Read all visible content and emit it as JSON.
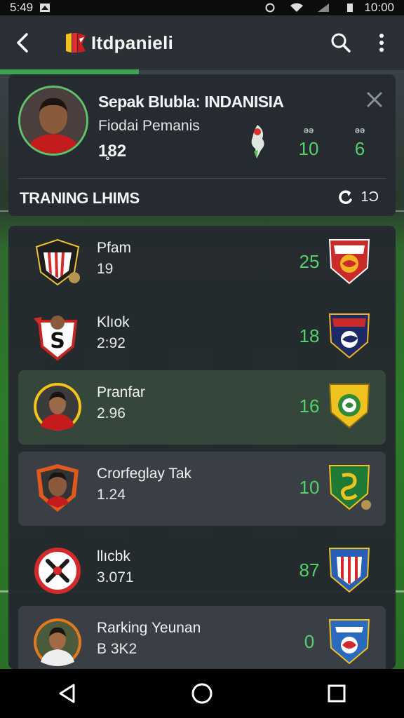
{
  "status_bar": {
    "time": "5:49",
    "clock_right": "10:00"
  },
  "app_bar": {
    "title": "Itdpanieli",
    "icons": [
      "back-arrow-icon",
      "app-logo-icon",
      "search-icon",
      "more-vert-icon"
    ]
  },
  "profile": {
    "name": "Sepak Blublaː INDANISIA",
    "subtitle": "Fiodai Pemanis",
    "number": "1̥82",
    "stats": [
      {
        "label": "ǝǝ",
        "value": "10"
      },
      {
        "label": "ǝǝ",
        "value": "6"
      }
    ]
  },
  "section": {
    "title": "TRANING LHIMS",
    "count": "1Ɔ"
  },
  "colors": {
    "accent_green": "#55d06a",
    "card_bg": "#262b31",
    "highlight": "#34473a"
  },
  "rows": [
    {
      "name": "Pfam",
      "sub": "19",
      "score": "25"
    },
    {
      "name": "Klıok",
      "sub": "2:92",
      "score": "18"
    },
    {
      "name": "Pranfar",
      "sub": "2.96",
      "score": "16"
    },
    {
      "name": "Crorfeglay Tak",
      "sub": "1.24",
      "score": "10"
    },
    {
      "name": "llıcbk",
      "sub": "3.071",
      "score": "87"
    },
    {
      "name": "Rarking Yeunan",
      "sub": "B 3K2",
      "score": "0"
    }
  ],
  "nav": {
    "icons": [
      "back-triangle-icon",
      "home-circle-icon",
      "recents-square-icon"
    ]
  }
}
